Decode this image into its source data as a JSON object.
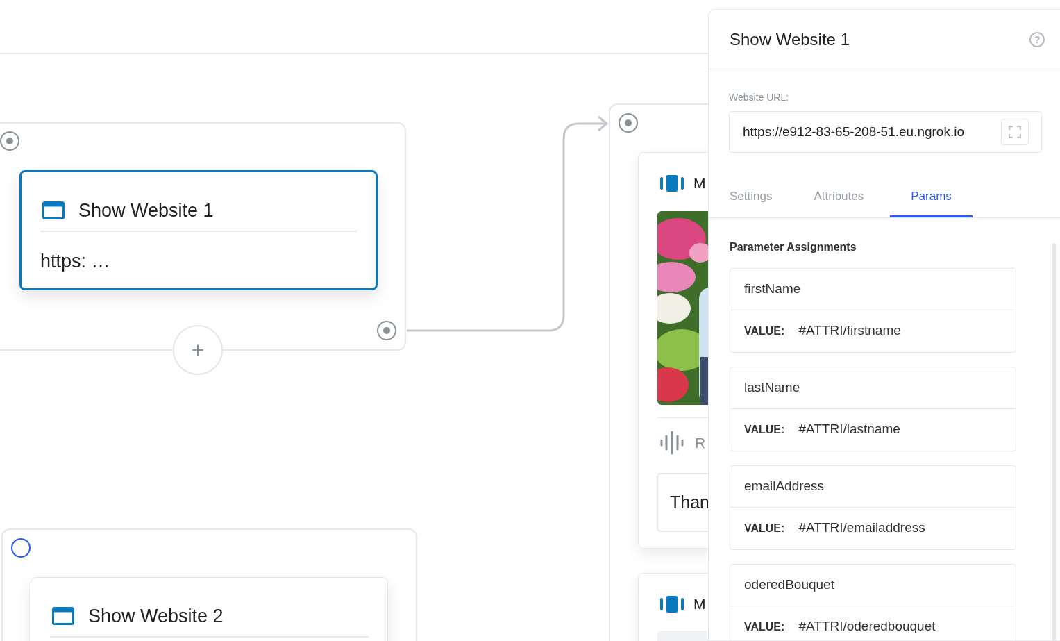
{
  "canvas": {
    "nodes": [
      {
        "kind": "website",
        "title": "Show Website 1",
        "preview": "https: …",
        "selected": true,
        "input_connected": true,
        "add_label": "+"
      },
      {
        "kind": "group",
        "input_connected": true,
        "cards": [
          {
            "sections": [
              {
                "kind": "carousel",
                "title": "M"
              },
              {
                "kind": "picture"
              },
              {
                "kind": "audio",
                "title": "R"
              },
              {
                "kind": "message",
                "text": "Than"
              }
            ]
          },
          {
            "sections": [
              {
                "kind": "carousel",
                "title": "M"
              },
              {
                "kind": "image-slot"
              }
            ]
          }
        ]
      },
      {
        "kind": "website",
        "title": "Show Website 2",
        "selected": false,
        "input_connected": false
      }
    ]
  },
  "panel": {
    "title": "Show Website 1",
    "help": "?",
    "url_label": "Website URL:",
    "url_value": "https://e912-83-65-208-51.eu.ngrok.io",
    "tabs": [
      {
        "label": "Settings",
        "selected": false
      },
      {
        "label": "Attributes",
        "selected": false
      },
      {
        "label": "Params",
        "selected": true
      }
    ],
    "section_title": "Parameter Assignments",
    "params": [
      {
        "name": "firstName",
        "value_label": "VALUE:",
        "value": "#ATTRI/firstname"
      },
      {
        "name": "lastName",
        "value_label": "VALUE:",
        "value": "#ATTRI/lastname"
      },
      {
        "name": "emailAddress",
        "value_label": "VALUE:",
        "value": "#ATTRI/emailaddress"
      },
      {
        "name": "oderedBouquet",
        "value_label": "VALUE:",
        "value": "#ATTRI/oderedbouquet"
      }
    ]
  }
}
